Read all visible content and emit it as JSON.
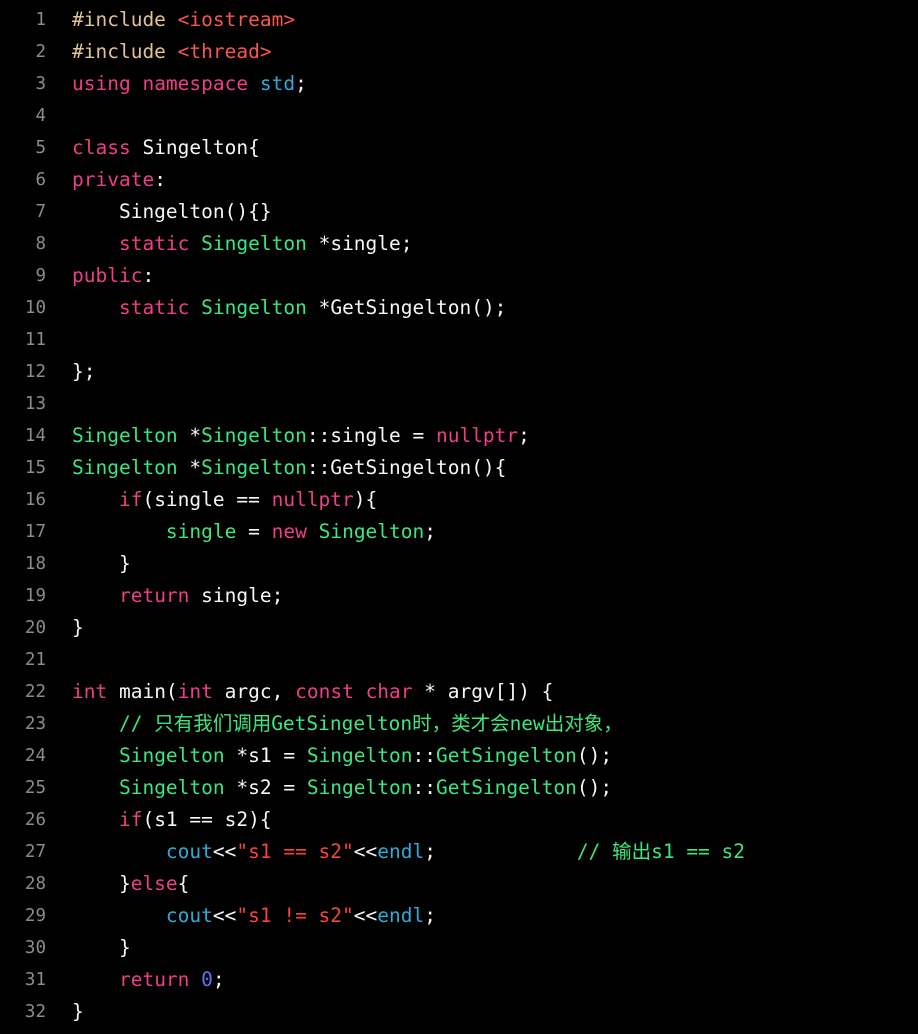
{
  "editor": {
    "language": "C++",
    "background_color": "#000000",
    "gutter_color": "#8c8c8c",
    "plain_text_color": "#f6f6f6",
    "first_line": 1,
    "last_line": 32,
    "total_lines": 32
  },
  "theme": {
    "keyword": "#ed3f87",
    "preprocessor": "#e3c391",
    "header": "#f8564f",
    "type": "#3ce77f",
    "namespace": "#2eaadc",
    "string": "#f8433c",
    "comment": "#3ce77f",
    "number": "#6272f0",
    "plain": "#f6f6f6"
  },
  "lines": [
    {
      "num": "1",
      "tokens": [
        {
          "t": "#include",
          "c": "t-pre"
        },
        {
          "t": " ",
          "c": "t-pl"
        },
        {
          "t": "<iostream>",
          "c": "t-hdr"
        }
      ]
    },
    {
      "num": "2",
      "tokens": [
        {
          "t": "#include",
          "c": "t-pre"
        },
        {
          "t": " ",
          "c": "t-pl"
        },
        {
          "t": "<thread>",
          "c": "t-hdr"
        }
      ]
    },
    {
      "num": "3",
      "tokens": [
        {
          "t": "using",
          "c": "t-kw"
        },
        {
          "t": " ",
          "c": "t-pl"
        },
        {
          "t": "namespace",
          "c": "t-kw"
        },
        {
          "t": " ",
          "c": "t-pl"
        },
        {
          "t": "std",
          "c": "t-ns"
        },
        {
          "t": ";",
          "c": "t-pl"
        }
      ]
    },
    {
      "num": "4",
      "tokens": []
    },
    {
      "num": "5",
      "tokens": [
        {
          "t": "class",
          "c": "t-kw"
        },
        {
          "t": " Singelton{",
          "c": "t-pl"
        }
      ]
    },
    {
      "num": "6",
      "tokens": [
        {
          "t": "private",
          "c": "t-kw"
        },
        {
          "t": ":",
          "c": "t-pl"
        }
      ]
    },
    {
      "num": "7",
      "tokens": [
        {
          "t": "    Singelton(){}",
          "c": "t-pl"
        }
      ]
    },
    {
      "num": "8",
      "tokens": [
        {
          "t": "    ",
          "c": "t-pl"
        },
        {
          "t": "static",
          "c": "t-kw"
        },
        {
          "t": " ",
          "c": "t-pl"
        },
        {
          "t": "Singelton",
          "c": "t-type"
        },
        {
          "t": " *single;",
          "c": "t-pl"
        }
      ]
    },
    {
      "num": "9",
      "tokens": [
        {
          "t": "public",
          "c": "t-kw"
        },
        {
          "t": ":",
          "c": "t-pl"
        }
      ]
    },
    {
      "num": "10",
      "tokens": [
        {
          "t": "    ",
          "c": "t-pl"
        },
        {
          "t": "static",
          "c": "t-kw"
        },
        {
          "t": " ",
          "c": "t-pl"
        },
        {
          "t": "Singelton",
          "c": "t-type"
        },
        {
          "t": " *GetSingelton();",
          "c": "t-pl"
        }
      ]
    },
    {
      "num": "11",
      "tokens": []
    },
    {
      "num": "12",
      "tokens": [
        {
          "t": "};",
          "c": "t-pl"
        }
      ]
    },
    {
      "num": "13",
      "tokens": []
    },
    {
      "num": "14",
      "tokens": [
        {
          "t": "Singelton",
          "c": "t-type"
        },
        {
          "t": " *",
          "c": "t-pl"
        },
        {
          "t": "Singelton",
          "c": "t-type"
        },
        {
          "t": "::single = ",
          "c": "t-pl"
        },
        {
          "t": "nullptr",
          "c": "t-kw"
        },
        {
          "t": ";",
          "c": "t-pl"
        }
      ]
    },
    {
      "num": "15",
      "tokens": [
        {
          "t": "Singelton",
          "c": "t-type"
        },
        {
          "t": " *",
          "c": "t-pl"
        },
        {
          "t": "Singelton",
          "c": "t-type"
        },
        {
          "t": "::GetSingelton(){",
          "c": "t-pl"
        }
      ]
    },
    {
      "num": "16",
      "tokens": [
        {
          "t": "    ",
          "c": "t-pl"
        },
        {
          "t": "if",
          "c": "t-kw"
        },
        {
          "t": "(single == ",
          "c": "t-pl"
        },
        {
          "t": "nullptr",
          "c": "t-kw"
        },
        {
          "t": "){",
          "c": "t-pl"
        }
      ]
    },
    {
      "num": "17",
      "tokens": [
        {
          "t": "        ",
          "c": "t-pl"
        },
        {
          "t": "single",
          "c": "t-type"
        },
        {
          "t": " = ",
          "c": "t-pl"
        },
        {
          "t": "new",
          "c": "t-kw"
        },
        {
          "t": " ",
          "c": "t-pl"
        },
        {
          "t": "Singelton",
          "c": "t-type"
        },
        {
          "t": ";",
          "c": "t-pl"
        }
      ]
    },
    {
      "num": "18",
      "tokens": [
        {
          "t": "    }",
          "c": "t-pl"
        }
      ]
    },
    {
      "num": "19",
      "tokens": [
        {
          "t": "    ",
          "c": "t-pl"
        },
        {
          "t": "return",
          "c": "t-kw"
        },
        {
          "t": " single;",
          "c": "t-pl"
        }
      ]
    },
    {
      "num": "20",
      "tokens": [
        {
          "t": "}",
          "c": "t-pl"
        }
      ]
    },
    {
      "num": "21",
      "tokens": []
    },
    {
      "num": "22",
      "tokens": [
        {
          "t": "int",
          "c": "t-kw"
        },
        {
          "t": " main(",
          "c": "t-pl"
        },
        {
          "t": "int",
          "c": "t-kw"
        },
        {
          "t": " argc, ",
          "c": "t-pl"
        },
        {
          "t": "const",
          "c": "t-kw"
        },
        {
          "t": " ",
          "c": "t-pl"
        },
        {
          "t": "char",
          "c": "t-kw"
        },
        {
          "t": " * argv[]) {",
          "c": "t-pl"
        }
      ]
    },
    {
      "num": "23",
      "tokens": [
        {
          "t": "    ",
          "c": "t-pl"
        },
        {
          "t": "// 只有我们调用GetSingelton时，类才会new出对象，",
          "c": "t-cmt"
        }
      ]
    },
    {
      "num": "24",
      "tokens": [
        {
          "t": "    ",
          "c": "t-pl"
        },
        {
          "t": "Singelton",
          "c": "t-type"
        },
        {
          "t": " *s1 = ",
          "c": "t-pl"
        },
        {
          "t": "Singelton",
          "c": "t-type"
        },
        {
          "t": "::",
          "c": "t-pl"
        },
        {
          "t": "GetSingelton",
          "c": "t-type"
        },
        {
          "t": "();",
          "c": "t-pl"
        }
      ]
    },
    {
      "num": "25",
      "tokens": [
        {
          "t": "    ",
          "c": "t-pl"
        },
        {
          "t": "Singelton",
          "c": "t-type"
        },
        {
          "t": " *s2 = ",
          "c": "t-pl"
        },
        {
          "t": "Singelton",
          "c": "t-type"
        },
        {
          "t": "::",
          "c": "t-pl"
        },
        {
          "t": "GetSingelton",
          "c": "t-type"
        },
        {
          "t": "();",
          "c": "t-pl"
        }
      ]
    },
    {
      "num": "26",
      "tokens": [
        {
          "t": "    ",
          "c": "t-pl"
        },
        {
          "t": "if",
          "c": "t-kw"
        },
        {
          "t": "(s1 == s2){",
          "c": "t-pl"
        }
      ]
    },
    {
      "num": "27",
      "tokens": [
        {
          "t": "        ",
          "c": "t-pl"
        },
        {
          "t": "cout",
          "c": "t-ns"
        },
        {
          "t": "<<",
          "c": "t-pl"
        },
        {
          "t": "\"s1 == s2\"",
          "c": "t-str"
        },
        {
          "t": "<<",
          "c": "t-pl"
        },
        {
          "t": "endl",
          "c": "t-ns"
        },
        {
          "t": ";",
          "c": "t-pl"
        },
        {
          "t": "            ",
          "c": "t-pl"
        },
        {
          "t": "// 输出s1 == s2",
          "c": "t-cmt"
        }
      ]
    },
    {
      "num": "28",
      "tokens": [
        {
          "t": "    }",
          "c": "t-pl"
        },
        {
          "t": "else",
          "c": "t-kw"
        },
        {
          "t": "{",
          "c": "t-pl"
        }
      ]
    },
    {
      "num": "29",
      "tokens": [
        {
          "t": "        ",
          "c": "t-pl"
        },
        {
          "t": "cout",
          "c": "t-ns"
        },
        {
          "t": "<<",
          "c": "t-pl"
        },
        {
          "t": "\"s1 != s2\"",
          "c": "t-str"
        },
        {
          "t": "<<",
          "c": "t-pl"
        },
        {
          "t": "endl",
          "c": "t-ns"
        },
        {
          "t": ";",
          "c": "t-pl"
        }
      ]
    },
    {
      "num": "30",
      "tokens": [
        {
          "t": "    }",
          "c": "t-pl"
        }
      ]
    },
    {
      "num": "31",
      "tokens": [
        {
          "t": "    ",
          "c": "t-pl"
        },
        {
          "t": "return",
          "c": "t-kw"
        },
        {
          "t": " ",
          "c": "t-pl"
        },
        {
          "t": "0",
          "c": "t-num"
        },
        {
          "t": ";",
          "c": "t-pl"
        }
      ]
    },
    {
      "num": "32",
      "tokens": [
        {
          "t": "}",
          "c": "t-pl"
        }
      ]
    }
  ]
}
